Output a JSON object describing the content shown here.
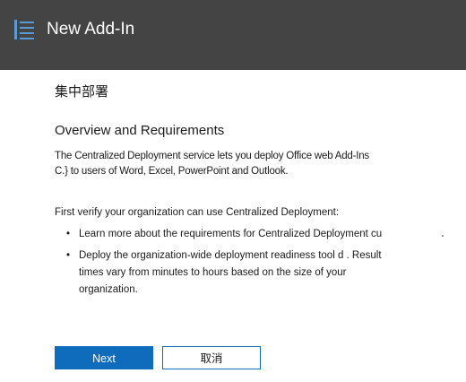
{
  "header": {
    "title": "New Add-In",
    "icon": "list-menu-icon",
    "icon_color": "#5b9bd5",
    "background": "#444444"
  },
  "content": {
    "heading": "集中部署",
    "section_title": "Overview and Requirements",
    "description_lines": [
      "The Centralized Deployment service lets you deploy Office web Add-Ins",
      "C.} to users of Word, Excel, PowerPoint and Outlook."
    ],
    "verify_text": "First verify your organization can use Centralized Deployment:",
    "bullets": [
      "Learn more about the requirements for Centralized Deployment cu",
      "Deploy the organization-wide deployment readiness tool d . Result"
    ],
    "bullet_continuation": [
      "times vary from minutes to hours based on the size of your",
      "organization."
    ]
  },
  "buttons": {
    "next_label": "Next",
    "cancel_label": "取消",
    "primary_color": "#0f6cbd"
  }
}
